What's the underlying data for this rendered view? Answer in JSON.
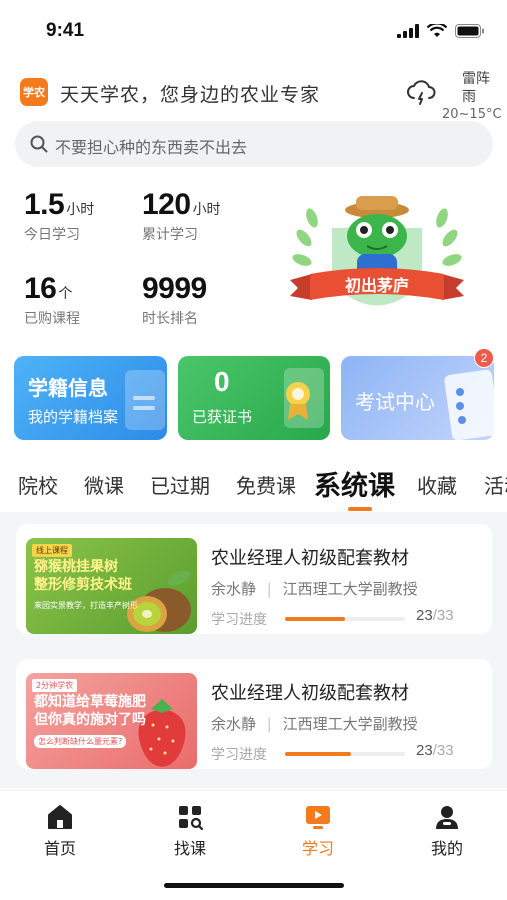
{
  "status_bar": {
    "time": "9:41"
  },
  "header": {
    "logo_text": "学农",
    "slogan": "天天学农，您身边的农业专家",
    "weather": {
      "condition": "雷阵雨",
      "temp": "20~15°C",
      "icon": "thunderstorm-cloud-icon"
    }
  },
  "search": {
    "placeholder": "不要担心种的东西卖不出去",
    "icon": "search-icon"
  },
  "stats": [
    {
      "value": "1.5",
      "unit": "小时",
      "label": "今日学习"
    },
    {
      "value": "120",
      "unit": "小时",
      "label": "累计学习"
    },
    {
      "value": "16",
      "unit": "个",
      "label": "已购课程"
    },
    {
      "value": "9999",
      "unit": "",
      "label": "时长排名"
    }
  ],
  "badge": {
    "title": "初出茅庐"
  },
  "cards": {
    "student": {
      "title": "学籍信息",
      "subtitle": "我的学籍档案"
    },
    "certificate": {
      "count": "0",
      "subtitle": "已获证书"
    },
    "exam": {
      "title": "考试中心",
      "badge_count": "2"
    }
  },
  "tabs": [
    "院校",
    "微课",
    "已过期",
    "免费课",
    "系统课",
    "收藏",
    "活动"
  ],
  "active_tab": "系统课",
  "courses": [
    {
      "thumb_tag": "线上课程",
      "thumb_title_1": "猕猴桃挂果树",
      "thumb_title_2": "整形修剪技术班",
      "thumb_sub": "来园实景教学，打造丰产树形",
      "title": "农业经理人初级配套教材",
      "teacher": "余水静",
      "org": "江西理工大学副教授",
      "progress_label": "学习进度",
      "progress_done": "23",
      "progress_total": "/33",
      "progress_fraction": 0.5
    },
    {
      "thumb_tag": "2分钟学农",
      "thumb_title_1": "都知道给草莓施肥",
      "thumb_title_2": "但你真的施对了吗",
      "thumb_sub": "怎么判断缺什么量元素?",
      "title": "农业经理人初级配套教材",
      "teacher": "余水静",
      "org": "江西理工大学副教授",
      "progress_label": "学习进度",
      "progress_done": "23",
      "progress_total": "/33",
      "progress_fraction": 0.55
    }
  ],
  "bottom_nav": [
    {
      "label": "首页",
      "icon": "home-icon"
    },
    {
      "label": "找课",
      "icon": "find-course-icon"
    },
    {
      "label": "学习",
      "icon": "study-icon"
    },
    {
      "label": "我的",
      "icon": "profile-icon"
    }
  ],
  "colors": {
    "accent": "#f37b1d",
    "progress_track": "#eceef1"
  }
}
